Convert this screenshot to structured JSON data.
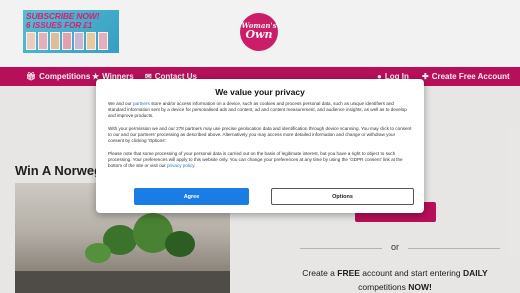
{
  "header": {
    "promo": {
      "line1": "SUBSCRIBE NOW!",
      "line2": "6 ISSUES FOR £1"
    },
    "logo": {
      "word1": "Woman's",
      "word2": "Own"
    }
  },
  "nav": {
    "items": [
      {
        "label": "Competitions",
        "icon": "gift-icon"
      },
      {
        "label": "Winners",
        "icon": "trophy-icon"
      },
      {
        "label": "Contact Us",
        "icon": "envelope-icon"
      }
    ],
    "login": {
      "label": "Log In",
      "icon": "user-icon"
    },
    "create_account": {
      "label": "Create Free Account",
      "icon": "user-plus-icon"
    }
  },
  "page": {
    "title": "Win A Norwegi",
    "side_title": "ers",
    "or_text": "or",
    "cta": {
      "prefix": "Create a ",
      "free": "FREE",
      "middle": " account and start entering ",
      "daily": "DAILY",
      "suffix": " competitions ",
      "now": "NOW!"
    }
  },
  "consent": {
    "title": "We value your privacy",
    "p1_prefix": "We and our ",
    "p1_link": "partners",
    "p1_suffix": " store and/or access information on a device, such as cookies and process personal data, such as unique identifiers and standard information sent by a device for personalised ads and content, ad and content measurement, and audience insights, as well as to develop and improve products.",
    "p2": "With your permission we and our 278 partners may use precise geolocation data and identification through device scanning. You may click to consent to our and our partners' processing as described above. Alternatively you may access more detailed information and change or withdraw your consent by clicking 'Options'.",
    "p3_prefix": "Please note that some processing of your personal data is carried out on the basis of legitimate interest, but you have a right to object to such processing. Your preferences will apply to this website only. You can change your preferences at any time by using the 'GDPR consent' link at the bottom of the site or visit our ",
    "p3_link": "privacy policy",
    "p3_suffix": ".",
    "agree_label": "Agree",
    "options_label": "Options"
  },
  "colors": {
    "brand": "#c1105e",
    "logo": "#d61f6e",
    "agree": "#1a7de6"
  }
}
